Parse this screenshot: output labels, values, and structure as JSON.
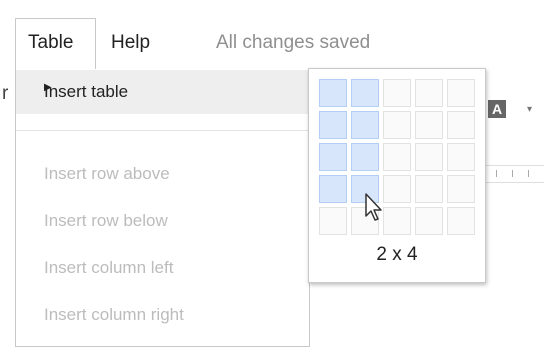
{
  "menubar": {
    "table_menu": "Table",
    "help_menu": "Help",
    "status": "All changes saved"
  },
  "dropdown": {
    "insert_table": "Insert table",
    "items_disabled": [
      "Insert row above",
      "Insert row below",
      "Insert column left",
      "Insert column right"
    ]
  },
  "table_picker": {
    "columns": 5,
    "rows": 5,
    "selected_columns": 2,
    "selected_rows": 4,
    "size_label": "2 x 4"
  },
  "toolbar": {
    "left_edge_text": "r",
    "font_color_label": "A",
    "font_color_icon": "text-color-icon"
  },
  "colors": {
    "selected_cell": "#d7e6fb",
    "hover_item": "#eeeeee",
    "disabled_text": "#bcbcbc"
  }
}
